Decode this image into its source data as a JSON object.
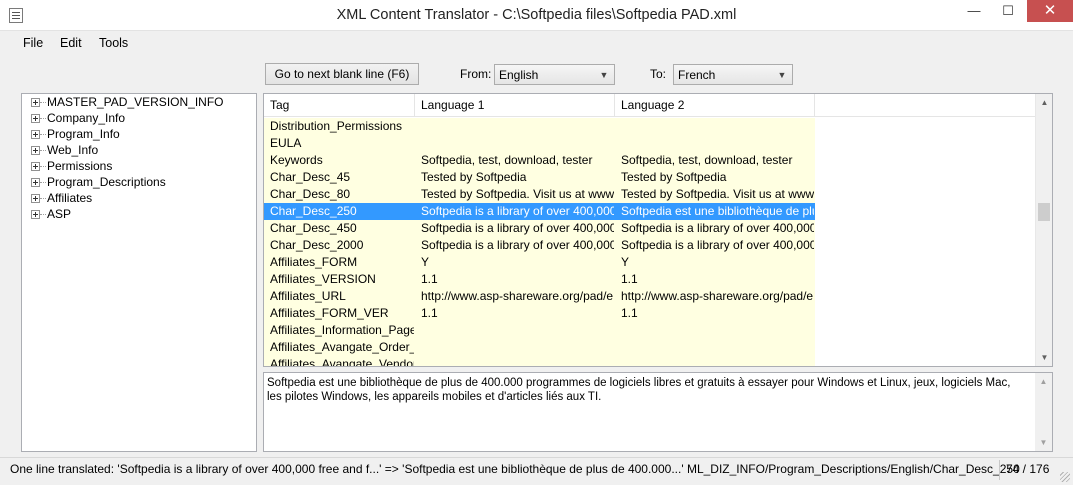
{
  "window": {
    "title": "XML Content Translator - C:\\Softpedia files\\Softpedia PAD.xml",
    "minimize": "—",
    "maximize": "☐",
    "close": "✕"
  },
  "menu": [
    "File",
    "Edit",
    "Tools"
  ],
  "toolbar": {
    "next_blank_label": "Go to next blank line (F6)",
    "from_label": "From:",
    "from_value": "English",
    "to_label": "To:",
    "to_value": "French"
  },
  "tree": [
    "MASTER_PAD_VERSION_INFO",
    "Company_Info",
    "Program_Info",
    "Web_Info",
    "Permissions",
    "Program_Descriptions",
    "Affiliates",
    "ASP"
  ],
  "grid": {
    "columns": [
      "Tag",
      "Language 1",
      "Language 2"
    ],
    "selected_row": 5,
    "rows": [
      {
        "tag": "Distribution_Permissions",
        "l1": "",
        "l2": ""
      },
      {
        "tag": "EULA",
        "l1": "",
        "l2": ""
      },
      {
        "tag": "Keywords",
        "l1": "Softpedia, test, download, tester",
        "l2": "Softpedia, test, download, tester"
      },
      {
        "tag": "Char_Desc_45",
        "l1": "Tested by Softpedia",
        "l2": "Tested by Softpedia"
      },
      {
        "tag": "Char_Desc_80",
        "l1": "Tested by Softpedia. Visit us at www....",
        "l2": "Tested by Softpedia. Visit us at www...."
      },
      {
        "tag": "Char_Desc_250",
        "l1": "Softpedia is a library of over 400,000 f...",
        "l2": "Softpedia est une bibliothèque de plu..."
      },
      {
        "tag": "Char_Desc_450",
        "l1": "Softpedia is a library of over 400,000 f...",
        "l2": "Softpedia is a library of over 400,000 f..."
      },
      {
        "tag": "Char_Desc_2000",
        "l1": "Softpedia is a library of over 400,000 f...",
        "l2": "Softpedia is a library of over 400,000 f..."
      },
      {
        "tag": "Affiliates_FORM",
        "l1": "Y",
        "l2": "Y"
      },
      {
        "tag": "Affiliates_VERSION",
        "l1": "1.1",
        "l2": "1.1"
      },
      {
        "tag": "Affiliates_URL",
        "l1": "http://www.asp-shareware.org/pad/e...",
        "l2": "http://www.asp-shareware.org/pad/e..."
      },
      {
        "tag": "Affiliates_FORM_VER",
        "l1": "1.1",
        "l2": "1.1"
      },
      {
        "tag": "Affiliates_Information_Page",
        "l1": "",
        "l2": ""
      },
      {
        "tag": "Affiliates_Avangate_Order_...",
        "l1": "",
        "l2": ""
      },
      {
        "tag": "Affiliates_Avangate_Vendor...",
        "l1": "",
        "l2": ""
      }
    ]
  },
  "detail_text": "Softpedia est une bibliothèque de plus de 400.000 programmes de logiciels libres et gratuits à essayer pour Windows et Linux, jeux, logiciels Mac, les pilotes Windows, les appareils mobiles et d'articles liés aux TI.",
  "status": {
    "message": "One line translated: 'Softpedia is a library of over 400,000 free and f...' => 'Softpedia est une bibliothèque de plus de 400.000...' ML_DIZ_INFO/Program_Descriptions/English/Char_Desc_250",
    "count": "74 / 176"
  },
  "colors": {
    "row_background": "#ffffe1",
    "selection": "#3399ff",
    "close_button": "#c75050"
  }
}
